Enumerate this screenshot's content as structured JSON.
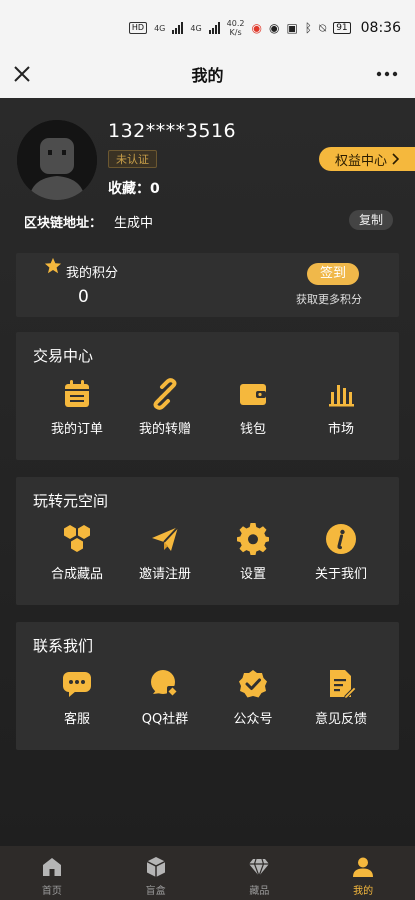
{
  "status_bar": {
    "hd": "HD",
    "net_1": "4G",
    "net_2": "4G",
    "speed_value": "40.2",
    "speed_unit": "K/s",
    "battery": "91",
    "time": "08:36"
  },
  "nav": {
    "title": "我的"
  },
  "profile": {
    "phone": "132****3516",
    "cert_status": "未认证",
    "collect_text": "收藏：0",
    "rights_center": "权益中心",
    "chain_label": "区块链地址：",
    "chain_value": "生成中",
    "copy_label": "复制"
  },
  "points": {
    "title": "我的积分",
    "value": "0",
    "signin_label": "签到",
    "hint": "获取更多积分"
  },
  "trade": {
    "title": "交易中心",
    "items": [
      {
        "label": "我的订单",
        "icon": "calendar-icon"
      },
      {
        "label": "我的转赠",
        "icon": "link-icon"
      },
      {
        "label": "钱包",
        "icon": "wallet-icon"
      },
      {
        "label": "市场",
        "icon": "bar-chart-icon"
      }
    ]
  },
  "space": {
    "title": "玩转元空间",
    "items": [
      {
        "label": "合成藏品",
        "icon": "hexagons-icon"
      },
      {
        "label": "邀请注册",
        "icon": "paper-plane-icon"
      },
      {
        "label": "设置",
        "icon": "gear-icon"
      },
      {
        "label": "关于我们",
        "icon": "info-icon"
      }
    ]
  },
  "contact": {
    "title": "联系我们",
    "items": [
      {
        "label": "客服",
        "icon": "chat-icon"
      },
      {
        "label": "QQ社群",
        "icon": "qq-group-icon"
      },
      {
        "label": "公众号",
        "icon": "verified-badge-icon"
      },
      {
        "label": "意见反馈",
        "icon": "feedback-icon"
      }
    ]
  },
  "tabs": [
    {
      "label": "首页",
      "icon": "home-icon"
    },
    {
      "label": "盲盒",
      "icon": "box-icon"
    },
    {
      "label": "藏品",
      "icon": "diamond-icon"
    },
    {
      "label": "我的",
      "icon": "user-icon",
      "active": true
    }
  ],
  "colors": {
    "accent": "#f5b83d",
    "background": "#262626",
    "card": "#303030",
    "tabbar": "#2e2b29"
  }
}
